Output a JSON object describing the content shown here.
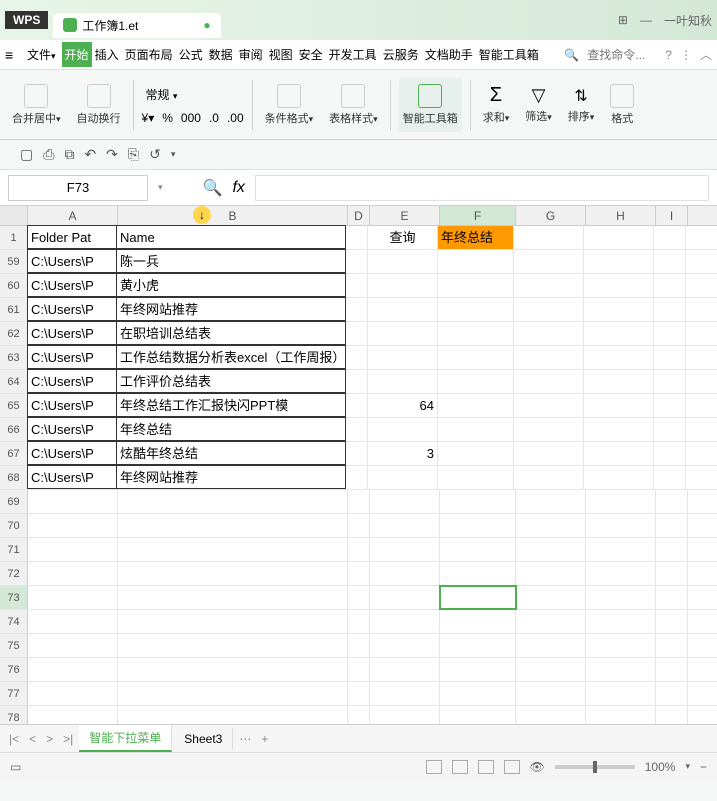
{
  "title": {
    "app": "WPS",
    "tab": "工作簿1.et",
    "user": "一叶知秋"
  },
  "menu": {
    "file": "文件",
    "tabs": [
      "开始",
      "插入",
      "页面布局",
      "公式",
      "数据",
      "审阅",
      "视图",
      "安全",
      "开发工具",
      "云服务",
      "文档助手",
      "智能工具箱"
    ],
    "search_placeholder": "查找命令..."
  },
  "ribbon": {
    "merge_center": "合并居中",
    "auto_wrap": "自动换行",
    "format_label": "常规",
    "percent": "%",
    "cond_format": "条件格式",
    "table_style": "表格样式",
    "smart_toolbox": "智能工具箱",
    "sum": "求和",
    "filter": "筛选",
    "sort": "排序",
    "format": "格式"
  },
  "formula": {
    "name_box": "F73",
    "fx": ""
  },
  "columns": [
    "A",
    "B",
    "D",
    "E",
    "F",
    "G",
    "H",
    "I"
  ],
  "col_widths": {
    "A": 90,
    "B": 230,
    "D": 22,
    "E": 70,
    "F": 76,
    "G": 70,
    "H": 70,
    "I": 32
  },
  "header_row": {
    "num": "1",
    "A": "Folder Pat",
    "B": "Name",
    "E": "查询",
    "F": "年终总结"
  },
  "rows": [
    {
      "num": "59",
      "A": "C:\\Users\\P",
      "B": "陈一兵"
    },
    {
      "num": "60",
      "A": "C:\\Users\\P",
      "B": "黄小虎"
    },
    {
      "num": "61",
      "A": "C:\\Users\\P",
      "B": "年终网站推荐"
    },
    {
      "num": "62",
      "A": "C:\\Users\\P",
      "B": "在职培训总结表"
    },
    {
      "num": "63",
      "A": "C:\\Users\\P",
      "B": "工作总结数据分析表excel（工作周报）"
    },
    {
      "num": "64",
      "A": "C:\\Users\\P",
      "B": "工作评价总结表"
    },
    {
      "num": "65",
      "A": "C:\\Users\\P",
      "B": "年终总结工作汇报快闪PPT模",
      "E": "64"
    },
    {
      "num": "66",
      "A": "C:\\Users\\P",
      "B": "年终总结"
    },
    {
      "num": "67",
      "A": "C:\\Users\\P",
      "B": "炫酷年终总结",
      "E": "3"
    },
    {
      "num": "68",
      "A": "C:\\Users\\P",
      "B": "年终网站推荐"
    },
    {
      "num": "69"
    },
    {
      "num": "70"
    },
    {
      "num": "71"
    },
    {
      "num": "72"
    },
    {
      "num": "73",
      "selected": true
    },
    {
      "num": "74"
    },
    {
      "num": "75"
    },
    {
      "num": "76"
    },
    {
      "num": "77"
    },
    {
      "num": "78"
    }
  ],
  "sheets": {
    "active": "智能下拉菜单",
    "other": "Sheet3"
  },
  "status": {
    "zoom": "100%"
  }
}
